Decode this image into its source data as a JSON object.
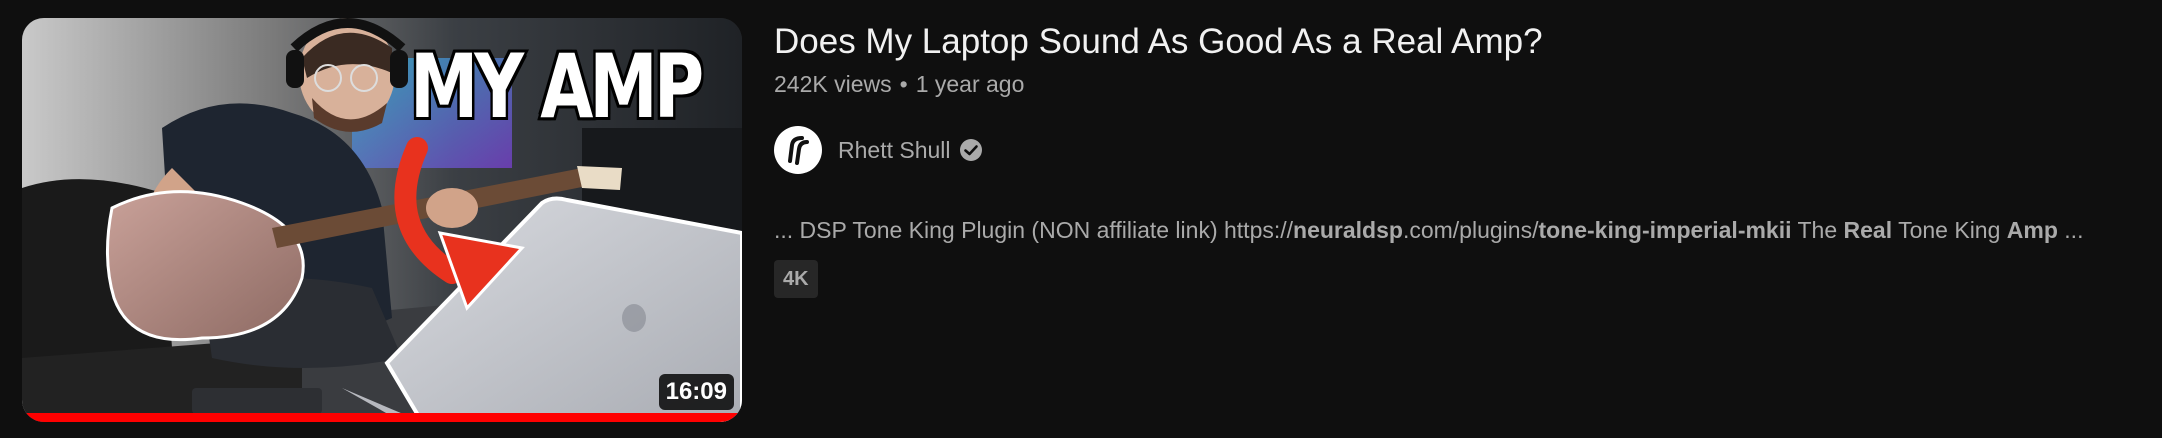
{
  "video": {
    "title": "Does My Laptop Sound As Good As a Real Amp?",
    "views": "242K views",
    "separator": "•",
    "age": "1 year ago",
    "duration": "16:09",
    "watch_progress_percent": 100,
    "thumbnail_text": "MY AMP",
    "badge": "4K"
  },
  "channel": {
    "name": "Rhett Shull",
    "avatar_icon": "rhett-shull-logo",
    "verified_icon": "verified-check-icon"
  },
  "snippet": {
    "parts": [
      {
        "text": "... DSP Tone King Plugin (NON affiliate link) https://",
        "bold": false
      },
      {
        "text": "neuraldsp",
        "bold": true
      },
      {
        "text": ".com/plugins/",
        "bold": false
      },
      {
        "text": "tone-king-imperial-mkii",
        "bold": true
      },
      {
        "text": " The ",
        "bold": false
      },
      {
        "text": "Real",
        "bold": true
      },
      {
        "text": " Tone King ",
        "bold": false
      },
      {
        "text": "Amp",
        "bold": true
      },
      {
        "text": " ...",
        "bold": false
      }
    ]
  },
  "colors": {
    "background": "#0f0f0f",
    "title": "#f1f1f1",
    "secondary_text": "#aaaaaa",
    "progress": "#ff0000",
    "badge_bg": "#272727"
  }
}
